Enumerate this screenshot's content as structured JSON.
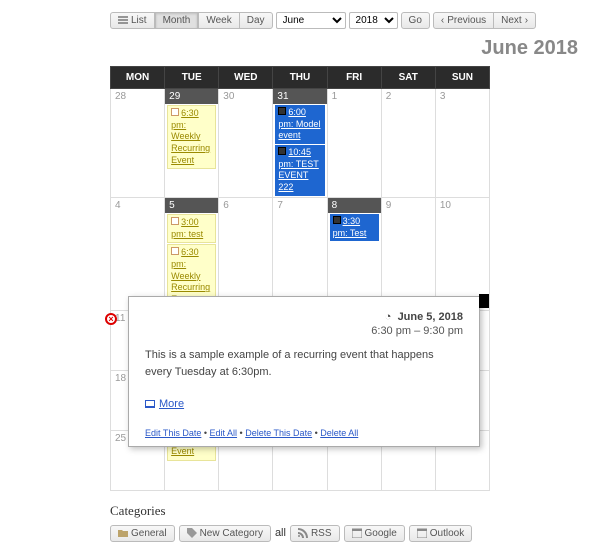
{
  "toolbar": {
    "list": "List",
    "month": "Month",
    "week": "Week",
    "day": "Day",
    "month_sel": "June",
    "year_sel": "2018",
    "go": "Go",
    "prev": "Previous",
    "next": "Next"
  },
  "title": "June 2018",
  "dow": [
    "MON",
    "TUE",
    "WED",
    "THU",
    "FRI",
    "SAT",
    "SUN"
  ],
  "grid": [
    [
      {
        "n": "28",
        "m": true
      },
      {
        "n": "29",
        "m": true,
        "d": true,
        "ev": [
          {
            "t": "6:30 pm: Weekly Recurring Event",
            "s": "y"
          }
        ]
      },
      {
        "n": "30",
        "m": true
      },
      {
        "n": "31",
        "m": true,
        "d": true,
        "ev": [
          {
            "t": "6:00 pm: Model event",
            "s": "b"
          },
          {
            "t": "10:45 pm: TEST EVENT 222",
            "s": "b"
          }
        ]
      },
      {
        "n": "1"
      },
      {
        "n": "2"
      },
      {
        "n": "3"
      }
    ],
    [
      {
        "n": "4"
      },
      {
        "n": "5",
        "d": true,
        "ev": [
          {
            "t": "3:00 pm: test",
            "s": "y"
          },
          {
            "t": "6:30 pm: Weekly Recurring Event",
            "s": "y"
          }
        ]
      },
      {
        "n": "6"
      },
      {
        "n": "7"
      },
      {
        "n": "8",
        "d": true,
        "ev": [
          {
            "t": "3:30 pm: Test",
            "s": "b"
          }
        ]
      },
      {
        "n": "9"
      },
      {
        "n": "10"
      }
    ],
    [
      {
        "n": "11",
        "x": true
      },
      {
        "n": ""
      },
      {
        "n": ""
      },
      {
        "n": ""
      },
      {
        "n": ""
      },
      {
        "n": ""
      },
      {
        "n": ""
      }
    ],
    [
      {
        "n": "18"
      },
      {
        "n": ""
      },
      {
        "n": ""
      },
      {
        "n": ""
      },
      {
        "n": ""
      },
      {
        "n": ""
      },
      {
        "n": ""
      }
    ],
    [
      {
        "n": "25"
      },
      {
        "n": "",
        "ev": [
          {
            "t": "Recurring Event",
            "s": "y",
            "bare": true
          }
        ]
      },
      {
        "n": ""
      },
      {
        "n": ""
      },
      {
        "n": ""
      },
      {
        "n": ""
      },
      {
        "n": ""
      }
    ]
  ],
  "popup": {
    "clock": "◔",
    "date": "June 5, 2018",
    "time": "6:30 pm – 9:30 pm",
    "desc": "This is a sample example of a recurring event that happens every Tuesday at 6:30pm.",
    "more": "More",
    "admin": [
      "Edit This Date",
      "Edit All",
      "Delete This Date",
      "Delete All"
    ],
    "sep": " • "
  },
  "categories": {
    "heading": "Categories",
    "items": [
      "General",
      "New Category"
    ],
    "all": "all",
    "feeds": [
      "RSS",
      "Google",
      "Outlook"
    ]
  }
}
